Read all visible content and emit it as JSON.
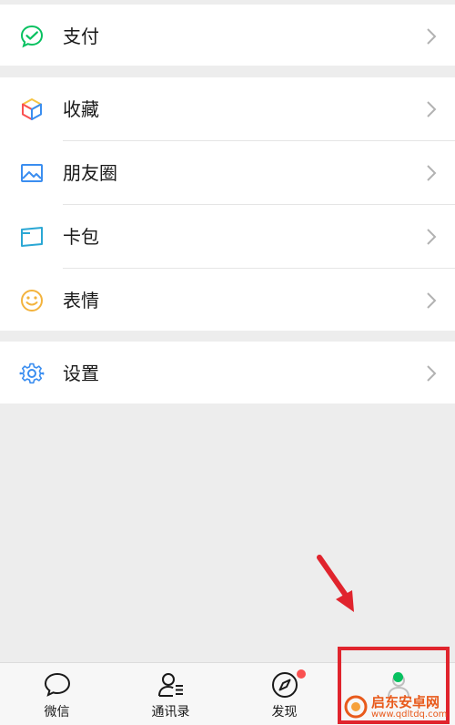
{
  "menu": {
    "pay": {
      "label": "支付",
      "icon": "pay-icon"
    },
    "items": [
      {
        "label": "收藏",
        "icon": "favorites-icon"
      },
      {
        "label": "朋友圈",
        "icon": "moments-icon"
      },
      {
        "label": "卡包",
        "icon": "card-package-icon"
      },
      {
        "label": "表情",
        "icon": "sticker-icon"
      }
    ],
    "settings": {
      "label": "设置",
      "icon": "settings-icon"
    }
  },
  "tabbar": {
    "tabs": [
      {
        "label": "微信",
        "icon": "chat-bubble-icon"
      },
      {
        "label": "通讯录",
        "icon": "contacts-icon"
      },
      {
        "label": "发现",
        "icon": "compass-icon"
      },
      {
        "label": "",
        "icon": "me-icon"
      }
    ],
    "discover_badge": "dot",
    "me_indicator": "green-dot"
  },
  "annotation": {
    "color": "#e0242d",
    "target": "me-tab"
  },
  "watermark": {
    "title": "启东安卓网",
    "url": "www.qdltdq.com"
  },
  "colors": {
    "background": "#ededed",
    "accent_green": "#07c160",
    "badge_red": "#fa5151"
  }
}
